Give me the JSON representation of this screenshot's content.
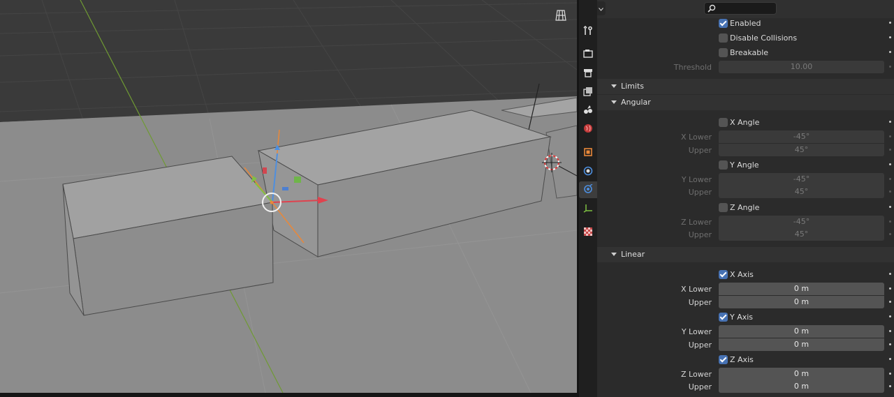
{
  "panel": {
    "checkboxes_top": [
      {
        "label": "Enabled",
        "checked": true
      },
      {
        "label": "Disable Collisions",
        "checked": false
      },
      {
        "label": "Breakable",
        "checked": false
      }
    ],
    "threshold": {
      "label": "Threshold",
      "value": "10.00"
    },
    "sections": {
      "limits": "Limits",
      "angular": "Angular",
      "linear": "Linear"
    },
    "angular": {
      "x": {
        "label": "X Angle",
        "checked": false,
        "lower_label": "X Lower",
        "lower": "-45°",
        "upper_label": "Upper",
        "upper": "45°"
      },
      "y": {
        "label": "Y Angle",
        "checked": false,
        "lower_label": "Y Lower",
        "lower": "-45°",
        "upper_label": "Upper",
        "upper": "45°"
      },
      "z": {
        "label": "Z Angle",
        "checked": false,
        "lower_label": "Z Lower",
        "lower": "-45°",
        "upper_label": "Upper",
        "upper": "45°"
      }
    },
    "linear": {
      "x": {
        "label": "X Axis",
        "checked": true,
        "lower_label": "X Lower",
        "lower": "0 m",
        "upper_label": "Upper",
        "upper": "0 m"
      },
      "y": {
        "label": "Y Axis",
        "checked": true,
        "lower_label": "Y Lower",
        "lower": "0 m",
        "upper_label": "Upper",
        "upper": "0 m"
      },
      "z": {
        "label": "Z Axis",
        "checked": true,
        "lower_label": "Z Lower",
        "lower": "0 m",
        "upper_label": "Upper",
        "upper": "0 m"
      }
    }
  },
  "tabs": [
    {
      "name": "tool-icon"
    },
    {
      "name": "render-icon"
    },
    {
      "name": "output-icon"
    },
    {
      "name": "view-layer-icon"
    },
    {
      "name": "scene-icon"
    },
    {
      "name": "world-icon"
    },
    {
      "name": "object-icon"
    },
    {
      "name": "physics-icon"
    },
    {
      "name": "constraint-icon"
    },
    {
      "name": "object-data-icon"
    },
    {
      "name": "texture-icon"
    }
  ],
  "colors": {
    "accent": "#4772b3",
    "x_axis": "#e0424e",
    "y_axis": "#7fc142",
    "z_axis": "#4d8fe0",
    "selection": "#e8883a"
  }
}
